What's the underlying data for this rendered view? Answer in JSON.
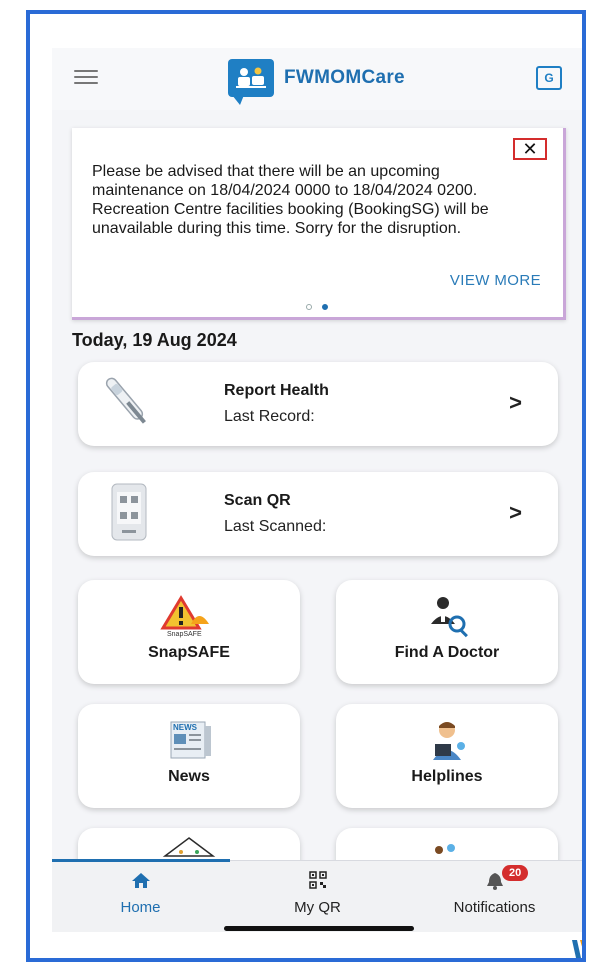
{
  "app": {
    "title": "FWMOMCare"
  },
  "banner": {
    "message": "Please be advised that there will be an upcoming maintenance on 18/04/2024 0000 to 18/04/2024 0200. Recreation Centre facilities booking (BookingSG) will be unavailable during this time. Sorry for the disruption.",
    "close_label": "✕",
    "view_more": "VIEW MORE",
    "slides_total": 2,
    "slide_active": 2
  },
  "date": "Today, 19 Aug 2024",
  "cards": {
    "report_health": {
      "title": "Report Health",
      "subtitle": "Last Record:"
    },
    "scan_qr": {
      "title": "Scan QR",
      "subtitle": "Last Scanned:"
    }
  },
  "tiles": {
    "snapsafe": {
      "label": "SnapSAFE",
      "icon_text": "SnapSAFE"
    },
    "find_doctor": {
      "label": "Find A Doctor"
    },
    "news": {
      "label": "News",
      "icon_text": "NEWS"
    },
    "helplines": {
      "label": "Helplines"
    }
  },
  "nav": {
    "home": "Home",
    "my_qr": "My QR",
    "notifications": "Notifications",
    "notification_count": "20"
  },
  "colors": {
    "accent": "#1f6fb0",
    "badge": "#d42d2d",
    "frame": "#2a6bd6"
  }
}
